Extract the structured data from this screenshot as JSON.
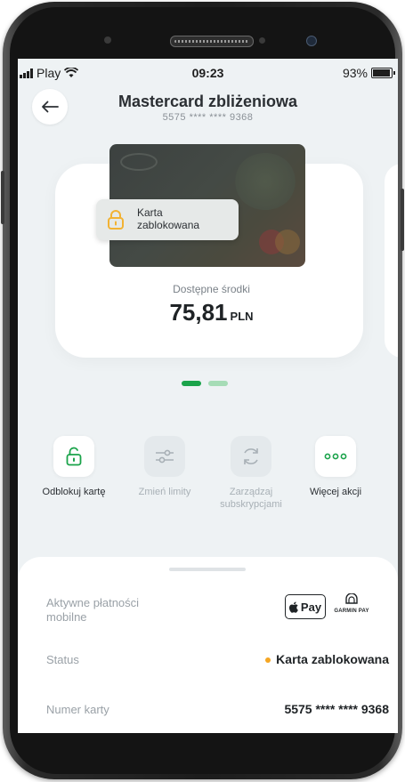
{
  "status_bar": {
    "carrier": "Play",
    "time": "09:23",
    "battery": "93%"
  },
  "header": {
    "title": "Mastercard zbliżeniowa",
    "card_number_masked": "5575 **** **** 9368"
  },
  "card": {
    "lock_label_line1": "Karta",
    "lock_label_line2": "zablokowana"
  },
  "balance": {
    "label": "Dostępne środki",
    "amount": "75,81",
    "currency": "PLN"
  },
  "pagination": {
    "total": 2,
    "active": 0
  },
  "actions": [
    {
      "label": "Odblokuj kartę",
      "icon": "unlock-icon",
      "enabled": true
    },
    {
      "label": "Zmień limity",
      "icon": "sliders-icon",
      "enabled": false
    },
    {
      "label": "Zarządzaj subskrypcjami",
      "icon": "refresh-icon",
      "enabled": false
    },
    {
      "label": "Więcej akcji",
      "icon": "more-icon",
      "enabled": true
    }
  ],
  "details": {
    "mobile_payments_label": "Aktywne płatności mobilne",
    "apple_pay_label": "Pay",
    "garmin_pay_label": "GARMIN PAY",
    "status_label": "Status",
    "status_value": "Karta zablokowana",
    "card_number_label": "Numer karty",
    "card_number_value": "5575 **** **** 9368"
  },
  "colors": {
    "accent_green": "#1aa34a",
    "status_orange": "#f5a623",
    "lock_yellow": "#f2b233",
    "disabled": "#a8b0b6"
  }
}
